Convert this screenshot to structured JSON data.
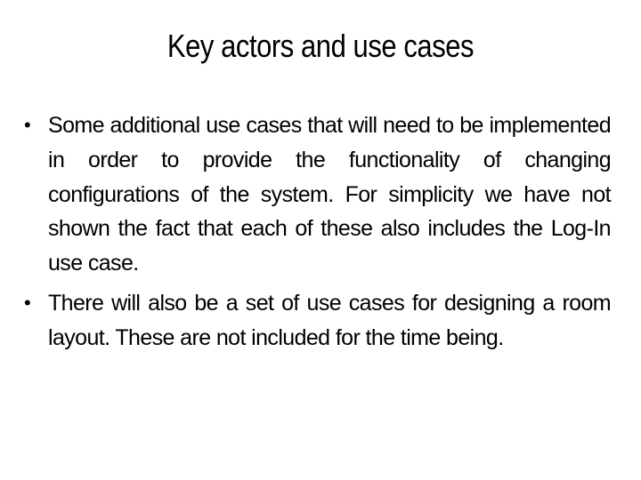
{
  "slide": {
    "title": "Key actors and use cases",
    "bullets": [
      {
        "marker": "•",
        "text": "Some additional use cases that will need to be implemented in order to provide the functionality of changing configurations of the system. For simplicity we have not shown the fact that each of these also includes the Log-In use case."
      },
      {
        "marker": "•",
        "text": "There will also be a set of use cases for designing a room layout. These are not included for the time being."
      }
    ]
  }
}
